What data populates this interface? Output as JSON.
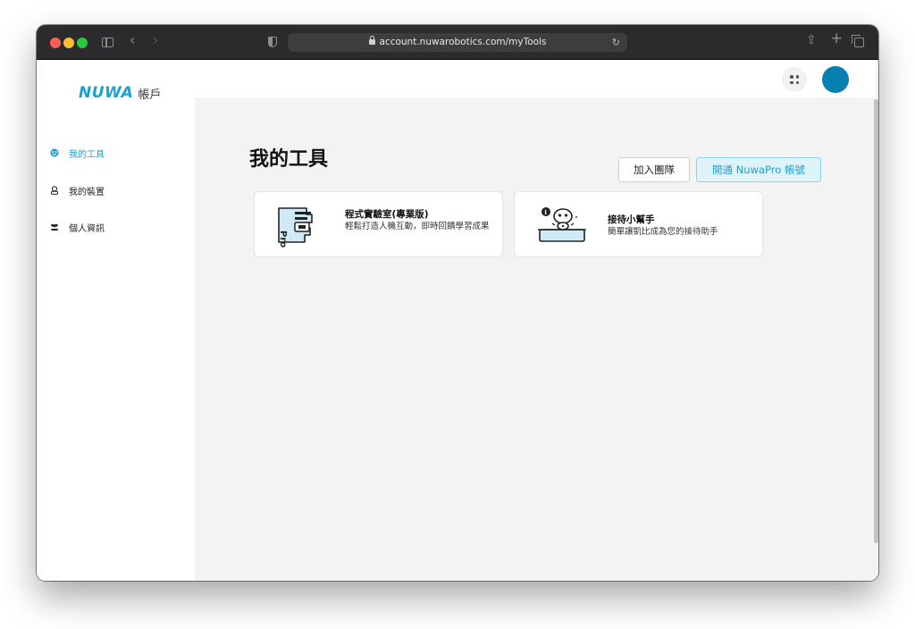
{
  "browser": {
    "url": "account.nuwarobotics.com/myTools"
  },
  "brand": {
    "logo": "NUWA",
    "sub": "帳戶"
  },
  "sidebar": {
    "items": [
      {
        "label": "我的工具",
        "icon": "toolbox-icon",
        "active": true
      },
      {
        "label": "我的裝置",
        "icon": "robot-icon",
        "active": false
      },
      {
        "label": "個人資訊",
        "icon": "people-icon",
        "active": false
      }
    ]
  },
  "main": {
    "title": "我的工具",
    "join_team_label": "加入團隊",
    "open_pro_label": "開通 NuwaPro 帳號",
    "tools": [
      {
        "title": "程式實驗室(專業版)",
        "description": "輕鬆打造人機互動，即時回饋學習成果",
        "icon": "code-lab-pro-icon",
        "icon_text": "Pro"
      },
      {
        "title": "接待小幫手",
        "description": "簡單讓凱比成為您的接待助手",
        "icon": "reception-robot-icon"
      }
    ]
  },
  "colors": {
    "accent": "#1aa1d0",
    "avatar": "#0680b1",
    "page_bg": "#f3f3f3"
  }
}
